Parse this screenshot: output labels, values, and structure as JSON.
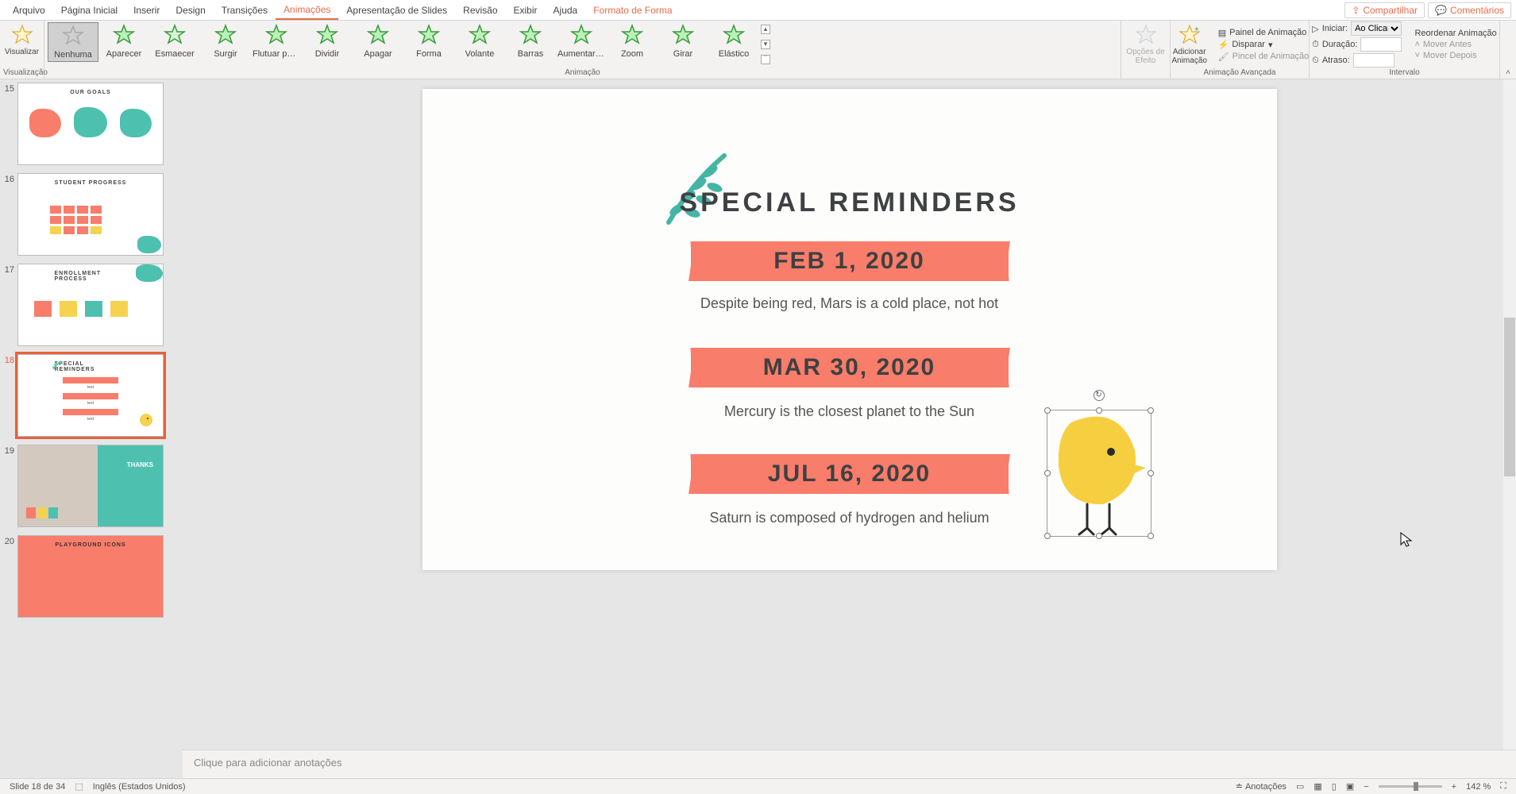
{
  "menu": {
    "items": [
      "Arquivo",
      "Página Inicial",
      "Inserir",
      "Design",
      "Transições",
      "Animações",
      "Apresentação de Slides",
      "Revisão",
      "Exibir",
      "Ajuda",
      "Formato de Forma"
    ],
    "active_index": 5,
    "format_index": 10,
    "share": "Compartilhar",
    "comments": "Comentários"
  },
  "ribbon": {
    "preview_group": {
      "label": "Visualização",
      "button": "Visualizar"
    },
    "animation_group": {
      "label": "Animação",
      "items": [
        "Nenhuma",
        "Aparecer",
        "Esmaecer",
        "Surgir",
        "Flutuar para...",
        "Dividir",
        "Apagar",
        "Forma",
        "Volante",
        "Barras",
        "Aumentar e...",
        "Zoom",
        "Girar",
        "Elástico"
      ],
      "selected_index": 0
    },
    "effect_options": {
      "label": "Opções de Efeito"
    },
    "add_animation": {
      "label": "Adicionar Animação"
    },
    "advanced_group": {
      "label": "Animação Avançada",
      "panel": "Painel de Animação",
      "trigger": "Disparar",
      "painter": "Pincel de Animação"
    },
    "timing_group": {
      "label": "Intervalo",
      "start": "Iniciar:",
      "start_value": "Ao Clicar",
      "duration": "Duração:",
      "duration_value": "",
      "delay": "Atraso:",
      "delay_value": "",
      "reorder": "Reordenar Animação",
      "move_before": "Mover Antes",
      "move_after": "Mover Depois"
    }
  },
  "thumbnails": {
    "visible": [
      {
        "num": 15,
        "title": "OUR GOALS"
      },
      {
        "num": 16,
        "title": "STUDENT PROGRESS"
      },
      {
        "num": 17,
        "title": "ENROLLMENT PROCESS"
      },
      {
        "num": 18,
        "title": "SPECIAL REMINDERS",
        "selected": true
      },
      {
        "num": 19,
        "title": "THANKS"
      },
      {
        "num": 20,
        "title": "PLAYGROUND ICONS"
      }
    ]
  },
  "slide": {
    "title": "SPECIAL REMINDERS",
    "reminders": [
      {
        "date": "FEB 1, 2020",
        "desc": "Despite being red, Mars is a cold place, not hot"
      },
      {
        "date": "MAR 30, 2020",
        "desc": "Mercury is the closest planet to the Sun"
      },
      {
        "date": "JUL 16, 2020",
        "desc": "Saturn is composed of hydrogen and helium"
      }
    ]
  },
  "notes": {
    "placeholder": "Clique para adicionar anotações"
  },
  "status": {
    "slide_counter": "Slide 18 de 34",
    "language": "Inglês (Estados Unidos)",
    "notes_btn": "Anotações",
    "zoom": "142 %"
  }
}
